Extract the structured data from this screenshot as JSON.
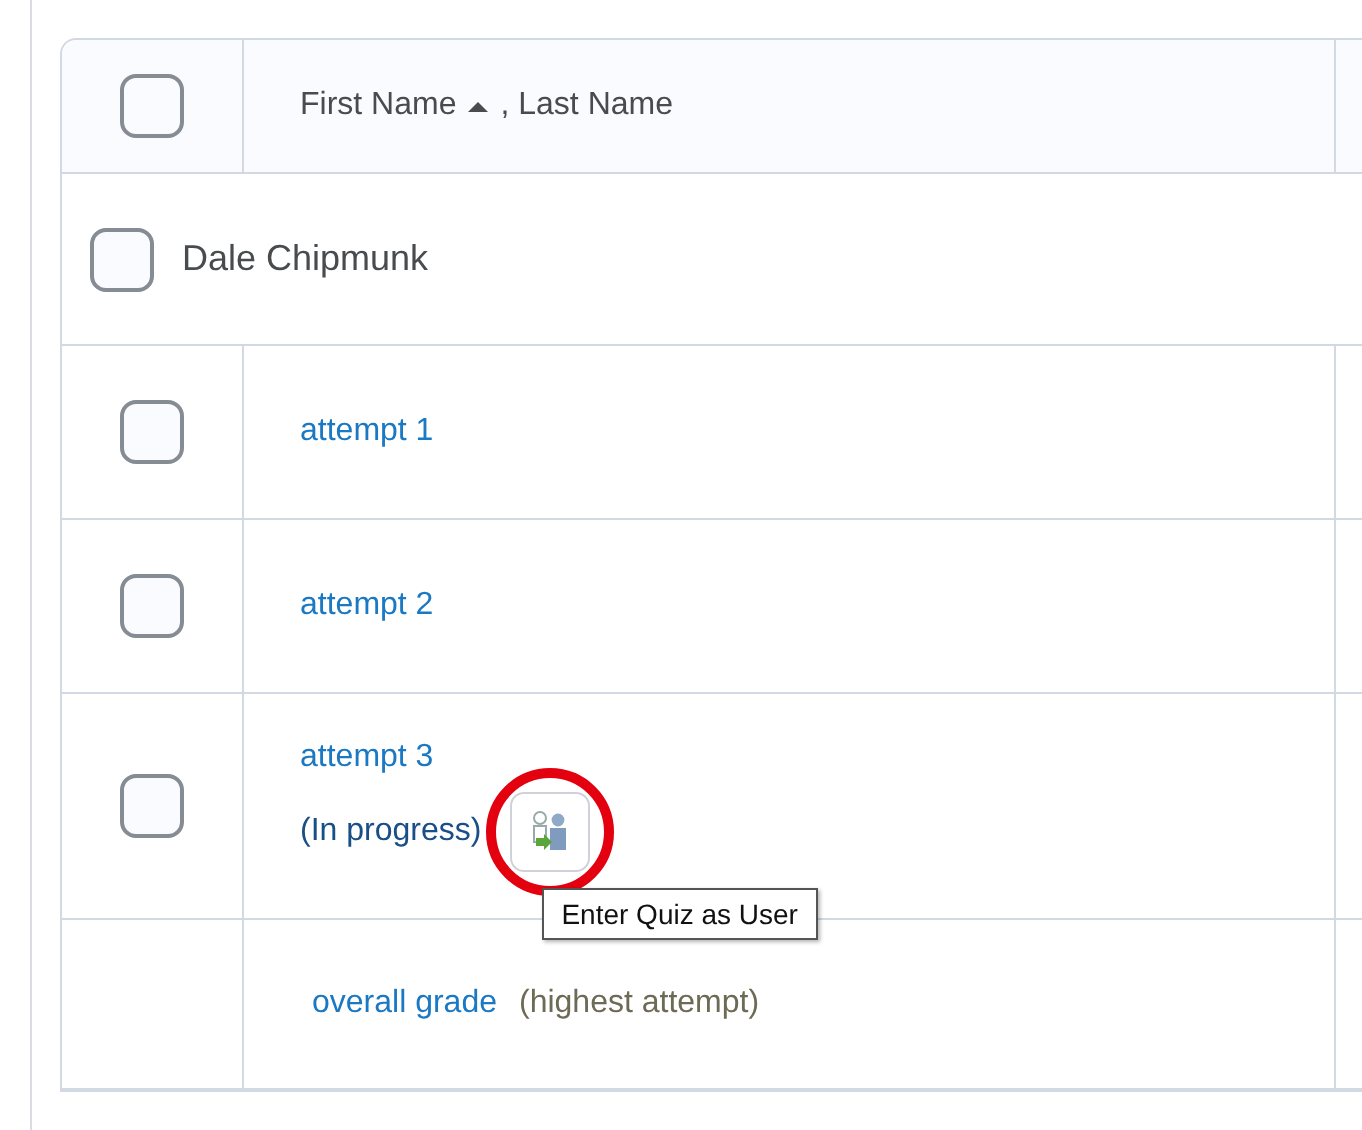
{
  "header": {
    "checked": false,
    "column_first": "First Name",
    "sorted_ascending": true,
    "column_last": ", Last Name"
  },
  "group": {
    "name": "Dale Chipmunk",
    "checked": false
  },
  "attempts": [
    {
      "label": "attempt 1",
      "checked": false
    },
    {
      "label": "attempt 2",
      "checked": false
    },
    {
      "label": "attempt 3",
      "checked": false,
      "status": "(In progress)",
      "action": {
        "tooltip": "Enter Quiz as User",
        "highlighted": true
      }
    }
  ],
  "summary": {
    "link": "overall grade",
    "note": "(highest attempt)"
  }
}
